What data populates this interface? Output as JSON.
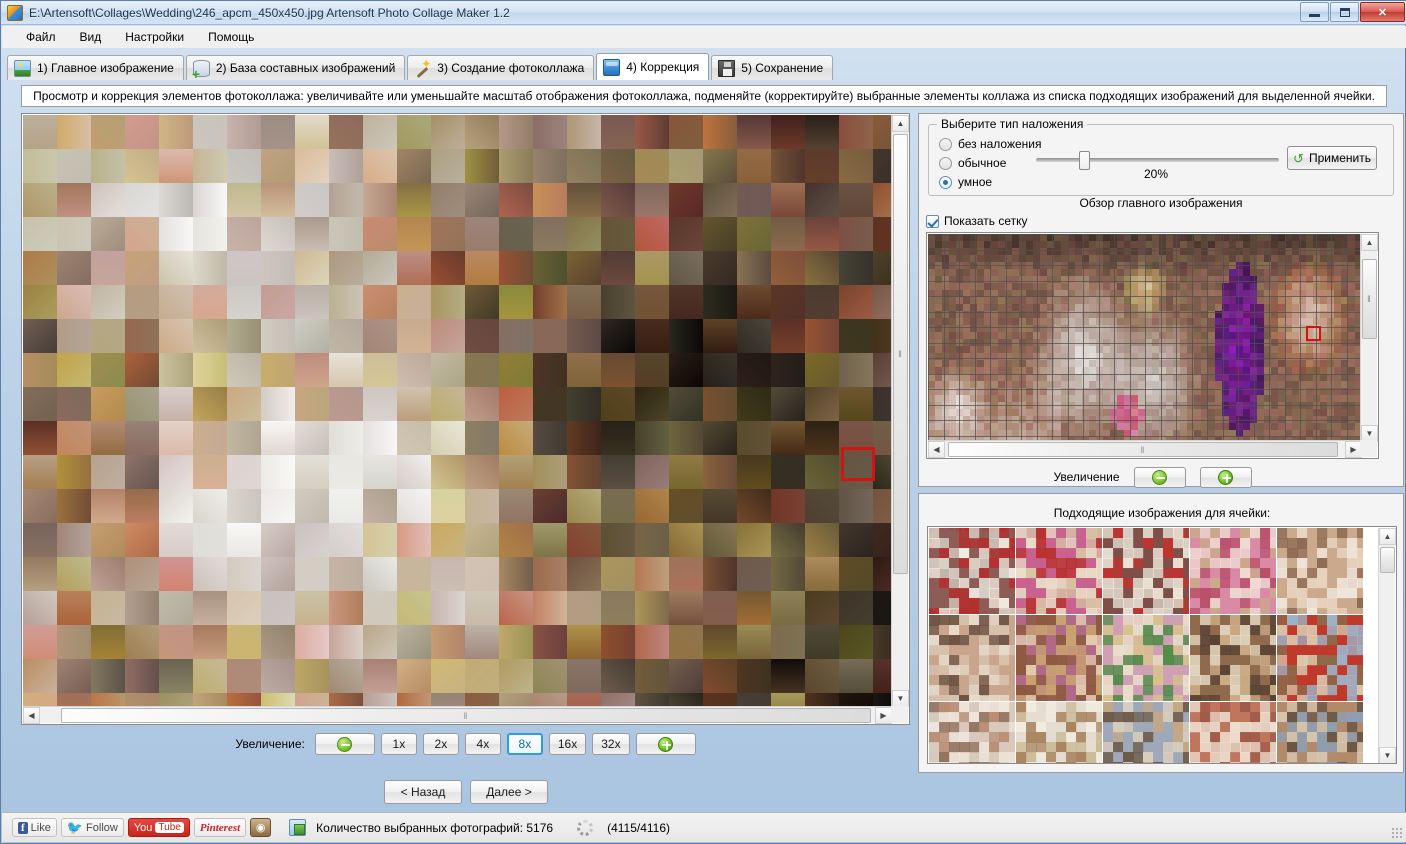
{
  "window": {
    "title": "E:\\Artensoft\\Collages\\Wedding\\246_apcm_450x450.jpg Artensoft Photo Collage Maker 1.2",
    "app_icon": "app-icon",
    "minimize_label": "",
    "maximize_label": "",
    "close_label": "✕"
  },
  "menu": {
    "items": [
      {
        "label": "Файл"
      },
      {
        "label": "Вид"
      },
      {
        "label": "Настройки"
      },
      {
        "label": "Помощь"
      }
    ]
  },
  "tabs": [
    {
      "label": "1) Главное изображение",
      "icon": "photo-icon",
      "active": false
    },
    {
      "label": "2) База составных изображений",
      "icon": "database-add-icon",
      "active": false
    },
    {
      "label": "3) Создание фотоколлажа",
      "icon": "magic-wand-icon",
      "active": false
    },
    {
      "label": "4) Коррекция",
      "icon": "blue-cube-icon",
      "active": true
    },
    {
      "label": "5) Сохранение",
      "icon": "floppy-save-icon",
      "active": false
    }
  ],
  "hint": "Просмотр и коррекция элементов фотоколлажа: увеличивайте или уменьшайте масштаб отображения фотоколлажа, подменяйте (корректируйте) выбранные элементы коллажа из списка подходящих изображений для выделенной ячейки.",
  "blend": {
    "group_title": "Выберите тип наложения",
    "options": [
      {
        "label": "без наложения",
        "selected": false
      },
      {
        "label": "обычное",
        "selected": false
      },
      {
        "label": "умное",
        "selected": true
      }
    ],
    "slider_value": "20%",
    "slider_percent": 20,
    "apply_label": "Применить",
    "apply_icon": "refresh-icon"
  },
  "preview": {
    "title": "Обзор главного изображения",
    "show_grid_label": "Показать сетку",
    "show_grid_checked": true,
    "zoom_label": "Увеличение",
    "zoom_out_icon": "zoom-out-icon",
    "zoom_in_icon": "zoom-in-icon"
  },
  "thumbs": {
    "title": "Подходящие изображения для ячейки:",
    "selected_index": 0
  },
  "zoombar": {
    "label": "Увеличение:",
    "zoom_out_icon": "zoom-out-icon",
    "zoom_in_icon": "zoom-in-icon",
    "levels": [
      "1x",
      "2x",
      "4x",
      "8x",
      "16x",
      "32x"
    ],
    "selected_level": "8x"
  },
  "nav": {
    "back_label": "< Назад",
    "next_label": "Далее >"
  },
  "status": {
    "social": [
      {
        "name": "facebook-like-button",
        "mark": "f",
        "label": "Like"
      },
      {
        "name": "twitter-follow-button",
        "mark": "ᴠ",
        "label": "Follow"
      },
      {
        "name": "youtube-button",
        "mark": "You",
        "label": "Tube"
      },
      {
        "name": "pinterest-button",
        "mark": "",
        "label": "Pinterest"
      },
      {
        "name": "instagram-button",
        "mark": "",
        "label": ""
      }
    ],
    "count_label": "Количество выбранных фотографий: 5176",
    "progress_text": "(4115/4116)"
  },
  "scroll": {
    "left_arrow": "◀",
    "right_arrow": "▶",
    "up_arrow": "▲",
    "down_arrow": "▼",
    "grip": "‖"
  },
  "colors": {
    "accent": "#2f9ddb",
    "selection_red": "#d01414",
    "green": "#62c21a",
    "window_blue": "#6b8fb5"
  }
}
